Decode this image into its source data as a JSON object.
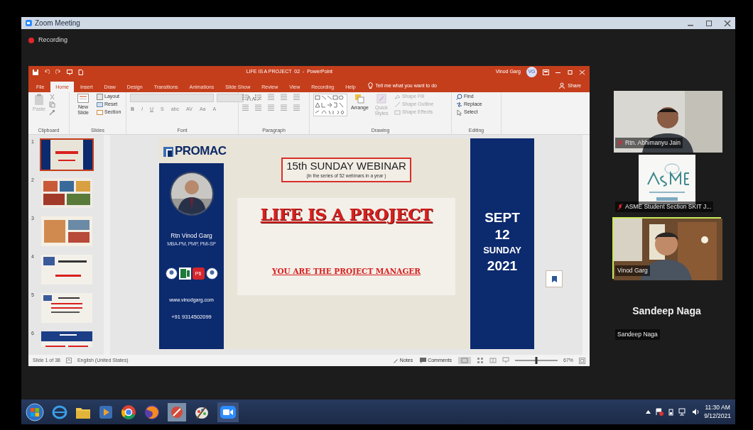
{
  "window": {
    "title": "Zoom Meeting"
  },
  "recording": {
    "label": "Recording"
  },
  "powerpoint": {
    "title": "LIFE IS A PROJECT  02  -  PowerPoint",
    "user": "Vinod Garg",
    "user_initials": "VG",
    "tabs": [
      {
        "label": "File",
        "selected": false
      },
      {
        "label": "Home",
        "selected": true
      },
      {
        "label": "Insert",
        "selected": false
      },
      {
        "label": "Draw",
        "selected": false
      },
      {
        "label": "Design",
        "selected": false
      },
      {
        "label": "Transitions",
        "selected": false
      },
      {
        "label": "Animations",
        "selected": false
      },
      {
        "label": "Slide Show",
        "selected": false
      },
      {
        "label": "Review",
        "selected": false
      },
      {
        "label": "View",
        "selected": false
      },
      {
        "label": "Recording",
        "selected": false
      },
      {
        "label": "Help",
        "selected": false
      }
    ],
    "tell_me": "Tell me what you want to do",
    "share": "Share",
    "ribbon": {
      "clipboard": {
        "label": "Clipboard",
        "paste": {
          "label": "Paste",
          "disabled": true
        }
      },
      "slides": {
        "label": "Slides",
        "new_slide": "New Slide",
        "items": [
          "Layout",
          "Reset",
          "Section"
        ]
      },
      "font": {
        "label": "Font",
        "buttons": [
          "B",
          "I",
          "U",
          "S",
          "abc",
          "AV",
          "Aa",
          "A"
        ]
      },
      "paragraph": {
        "label": "Paragraph"
      },
      "drawing": {
        "label": "Drawing",
        "arrange": "Arrange",
        "quick_styles": {
          "label": "Quick Styles",
          "disabled": true
        },
        "items": [
          {
            "label": "Shape Fill",
            "disabled": true
          },
          {
            "label": "Shape Outline",
            "disabled": true
          },
          {
            "label": "Shape Effects",
            "disabled": true
          }
        ]
      },
      "editing": {
        "label": "Editing",
        "items": [
          "Find",
          "Replace",
          "Select"
        ]
      }
    },
    "thumbnails": [
      {
        "number": "1",
        "selected": true
      },
      {
        "number": "2",
        "selected": false
      },
      {
        "number": "3",
        "selected": false
      },
      {
        "number": "4",
        "selected": false
      },
      {
        "number": "5",
        "selected": false
      },
      {
        "number": "6",
        "selected": false
      }
    ],
    "slide": {
      "logo": "PROMAC",
      "name": "Rtn Vinod Garg",
      "credentials": "MBA-PM, PMP, PMI-SP",
      "badge": "P6",
      "website": "www.vinodgarg.com",
      "phone": "+91 9314502099",
      "heading": "15th SUNDAY WEBINAR",
      "subheading": "(in the series of 52 webinars in a  year )",
      "title": "LIFE IS A PROJECT",
      "tagline": "YOU ARE THE PROJECT MANAGER",
      "date_lines": [
        "SEPT",
        "12",
        "SUNDAY",
        "2021"
      ]
    },
    "status_bar": {
      "slide": "Slide 1 of 38",
      "language": "English (United States)",
      "notes": "Notes",
      "comments": "Comments",
      "zoom": "67%",
      "level": 0.5
    }
  },
  "participants": [
    {
      "kind": "video",
      "name": "Rtn. Abhimanyu Jain",
      "muted": true,
      "speaking": false
    },
    {
      "kind": "logo",
      "name": "ASME Student Section SKIT J...",
      "muted": true,
      "speaking": false
    },
    {
      "kind": "video",
      "name": "Vinod Garg",
      "muted": false,
      "speaking": true
    },
    {
      "kind": "name",
      "display": "Sandeep Naga",
      "name": "Sandeep Naga",
      "muted": false,
      "speaking": false
    }
  ],
  "taskbar": {
    "time": "11:30 AM",
    "date": "9/12/2021"
  }
}
